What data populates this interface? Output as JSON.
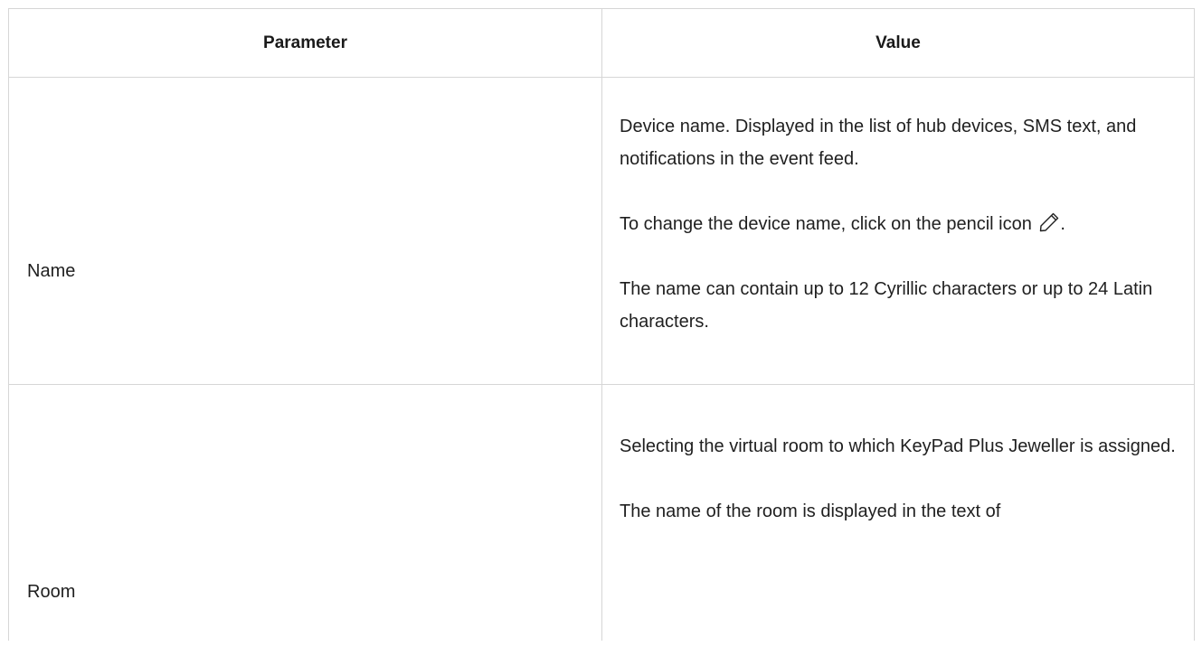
{
  "table": {
    "headers": {
      "parameter": "Parameter",
      "value": "Value"
    },
    "rows": [
      {
        "parameter": "Name",
        "paragraphs": [
          "Device name. Displayed in the list of hub devices, SMS text, and notifications in the event feed.",
          "To change the device name, click on the pencil icon",
          "The name can contain up to 12 Cyrillic characters or up to 24 Latin characters."
        ],
        "icon_suffix": ".",
        "icon": "pencil-icon"
      },
      {
        "parameter": "Room",
        "paragraphs": [
          "Selecting the virtual room to which KeyPad Plus Jeweller is assigned.",
          "The name of the room is displayed in the text of"
        ]
      }
    ]
  }
}
